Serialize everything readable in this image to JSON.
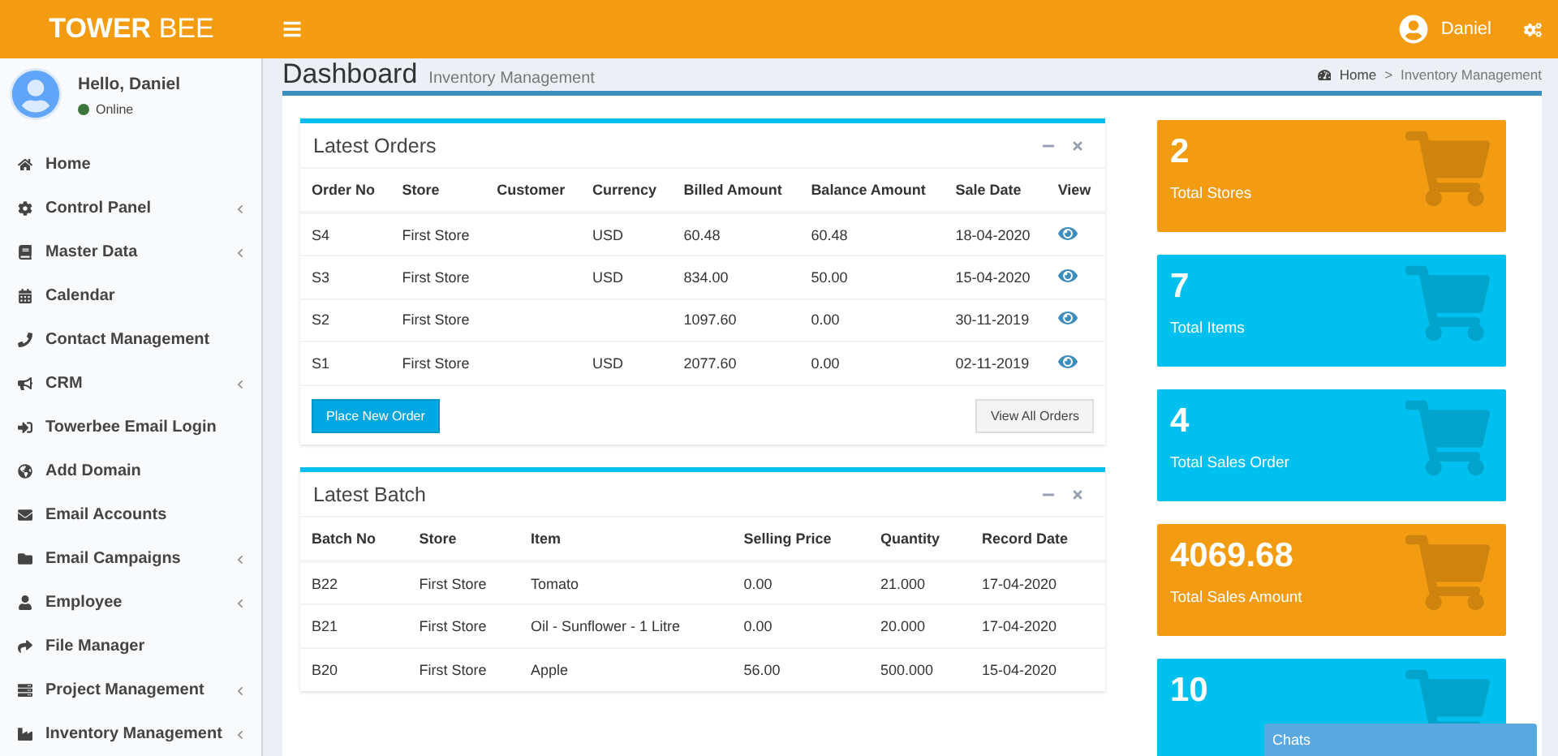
{
  "header": {
    "logo_bold": "TOWER",
    "logo_light": "BEE",
    "user": "Daniel"
  },
  "sidebar": {
    "user": {
      "greeting": "Hello, Daniel",
      "status": "Online",
      "online": true
    },
    "items": [
      {
        "label": "Home",
        "submenu": false
      },
      {
        "label": "Control Panel",
        "submenu": true
      },
      {
        "label": "Master Data",
        "submenu": true
      },
      {
        "label": "Calendar",
        "submenu": false
      },
      {
        "label": "Contact Management",
        "submenu": false
      },
      {
        "label": "CRM",
        "submenu": true
      },
      {
        "label": "Towerbee Email Login",
        "submenu": false
      },
      {
        "label": "Add Domain",
        "submenu": false
      },
      {
        "label": "Email Accounts",
        "submenu": false
      },
      {
        "label": "Email Campaigns",
        "submenu": true
      },
      {
        "label": "Employee",
        "submenu": true
      },
      {
        "label": "File Manager",
        "submenu": false
      },
      {
        "label": "Project Management",
        "submenu": true
      },
      {
        "label": "Inventory Management",
        "submenu": true
      }
    ]
  },
  "page": {
    "title": "Dashboard",
    "subtitle": "Inventory Management",
    "breadcrumb": [
      "Home",
      "Inventory Management"
    ],
    "separator": ">"
  },
  "orders": {
    "title": "Latest Orders",
    "columns": [
      "Order No",
      "Store",
      "Customer",
      "Currency",
      "Billed Amount",
      "Balance Amount",
      "Sale Date",
      "View"
    ],
    "rows": [
      [
        "S4",
        "First Store",
        "",
        "USD",
        "60.48",
        "60.48",
        "18-04-2020"
      ],
      [
        "S3",
        "First Store",
        "",
        "USD",
        "834.00",
        "50.00",
        "15-04-2020"
      ],
      [
        "S2",
        "First Store",
        "",
        "",
        "1097.60",
        "0.00",
        "30-11-2019"
      ],
      [
        "S1",
        "First Store",
        "",
        "USD",
        "2077.60",
        "0.00",
        "02-11-2019"
      ]
    ],
    "primary_button": "Place New Order",
    "secondary_button": "View All Orders"
  },
  "batch": {
    "title": "Latest Batch",
    "columns": [
      "Batch No",
      "Store",
      "Item",
      "Selling Price",
      "Quantity",
      "Record Date"
    ],
    "rows": [
      [
        "B22",
        "First Store",
        "Tomato",
        "0.00",
        "21.000",
        "17-04-2020"
      ],
      [
        "B21",
        "First Store",
        "Oil - Sunflower - 1 Litre",
        "0.00",
        "20.000",
        "17-04-2020"
      ],
      [
        "B20",
        "First Store",
        "Apple",
        "56.00",
        "500.000",
        "15-04-2020"
      ]
    ]
  },
  "stats": [
    {
      "value": "2",
      "label": "Total Stores",
      "color": "#f39c12"
    },
    {
      "value": "7",
      "label": "Total Items",
      "color": "#00c0ef"
    },
    {
      "value": "4",
      "label": "Total Sales Order",
      "color": "#00c0ef"
    },
    {
      "value": "4069.68",
      "label": "Total Sales Amount",
      "color": "#f39c12"
    },
    {
      "value": "10",
      "color": "#00c0ef"
    }
  ],
  "chat": {
    "title": "Chats"
  }
}
